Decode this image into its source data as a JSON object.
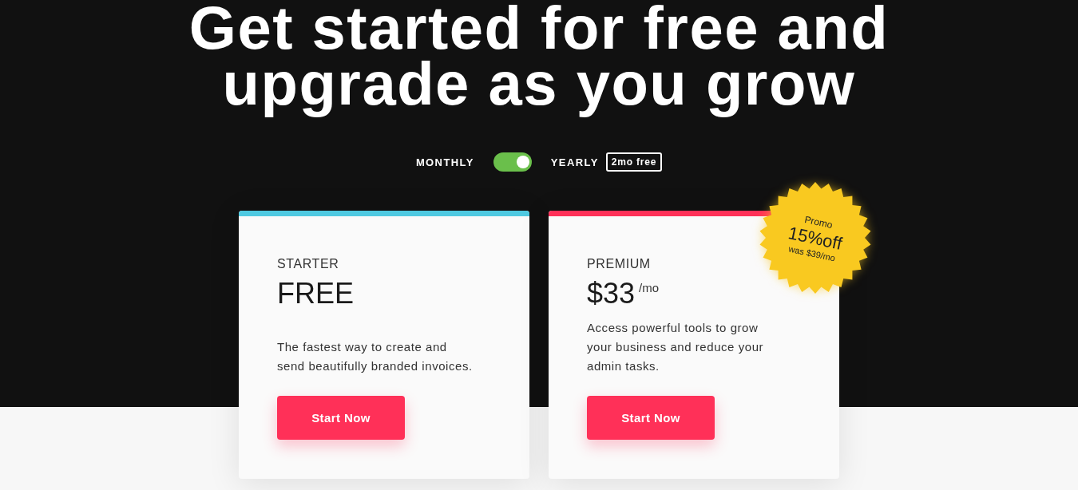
{
  "headline": "Get started for free and upgrade as you grow",
  "billing": {
    "monthly_label": "MONTHLY",
    "toggle": {
      "on": true
    },
    "yearly_label": "YEARLY",
    "yearly_badge": "2mo free"
  },
  "plans": [
    {
      "name": "STARTER",
      "price": "FREE",
      "description_lines": [
        "The fastest way to create and",
        "send beautifully branded invoices."
      ],
      "button": "Start Now",
      "color": "#4ec9e1"
    },
    {
      "name": "PREMIUM",
      "price": "$33",
      "price_unit": "/mo",
      "description_lines": [
        "Access powerful tools to grow",
        "your business and reduce your",
        "admin tasks."
      ],
      "button": "Start Now",
      "color": "#ff3058",
      "promo": {
        "label": "Promo",
        "discount": "15%off",
        "was": "was $39/mo"
      }
    }
  ]
}
